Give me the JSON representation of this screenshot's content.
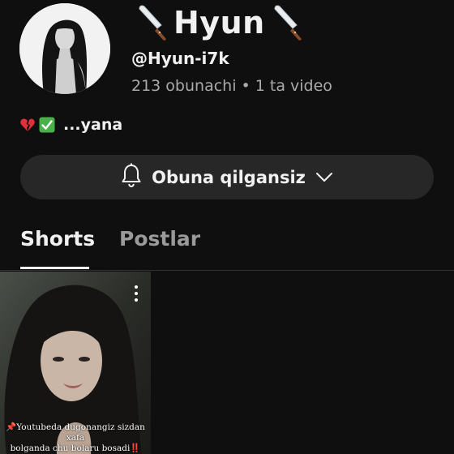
{
  "channel": {
    "name": "Hyun",
    "name_decoration_icon": "kitchen-knife-icon",
    "handle": "@Hyun-i7k",
    "stats": "213 obunachi • 1 ta video",
    "bio": {
      "emoji_icons": [
        "broken-heart-icon",
        "check-mark-button-icon"
      ],
      "text": "...yana"
    }
  },
  "subscribe": {
    "label": "Obuna qilgansiz",
    "icon": "bell-icon",
    "dropdown_icon": "chevron-down-icon"
  },
  "tabs": [
    {
      "label": "Shorts",
      "active": true
    },
    {
      "label": "Postlar",
      "active": false
    }
  ],
  "shorts": [
    {
      "caption_line1": "📌Youtubeda dugonangiz sizdan xafa",
      "caption_line2": "bolganda chu bolaru bosadi‼️",
      "menu_icon": "more-vert-icon"
    }
  ],
  "colors": {
    "background": "#0f0f0f",
    "button_bg": "#272727",
    "secondary_text": "#aaaaaa",
    "broken_heart": "#e0303a",
    "check_green": "#49b04a"
  }
}
